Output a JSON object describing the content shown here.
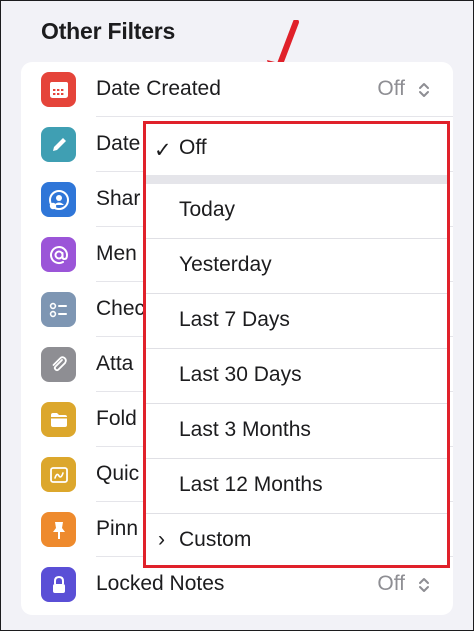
{
  "section": {
    "title": "Other Filters"
  },
  "rows": [
    {
      "label": "Date Created",
      "value": "Off",
      "icon": "calendar-icon",
      "color": "#e5443a"
    },
    {
      "label": "Date",
      "value": "",
      "icon": "pencil-icon",
      "color": "#3f9fb3"
    },
    {
      "label": "Shar",
      "value": "",
      "icon": "shared-person-icon",
      "color": "#2f76d8"
    },
    {
      "label": "Men",
      "value": "",
      "icon": "at-sign-icon",
      "color": "#9b55d8"
    },
    {
      "label": "Chec",
      "value": "",
      "icon": "checklist-icon",
      "color": "#7e96b3"
    },
    {
      "label": "Atta",
      "value": "",
      "icon": "paperclip-icon",
      "color": "#8e8e93"
    },
    {
      "label": "Fold",
      "value": "",
      "icon": "folder-icon",
      "color": "#dca72c"
    },
    {
      "label": "Quic",
      "value": "",
      "icon": "quick-note-icon",
      "color": "#dca72c"
    },
    {
      "label": "Pinn",
      "value": "",
      "icon": "pin-icon",
      "color": "#ee8a2d"
    },
    {
      "label": "Locked Notes",
      "value": "Off",
      "icon": "lock-icon",
      "color": "#5a4fd6"
    }
  ],
  "menu": {
    "selected": {
      "label": "Off",
      "mark": "✓"
    },
    "options": [
      "Today",
      "Yesterday",
      "Last 7 Days",
      "Last 30 Days",
      "Last 3 Months",
      "Last 12 Months"
    ],
    "custom": {
      "label": "Custom",
      "mark": "›"
    }
  },
  "colors": {
    "highlight_border": "#e0212a",
    "annotation_arrow": "#e0212a"
  }
}
